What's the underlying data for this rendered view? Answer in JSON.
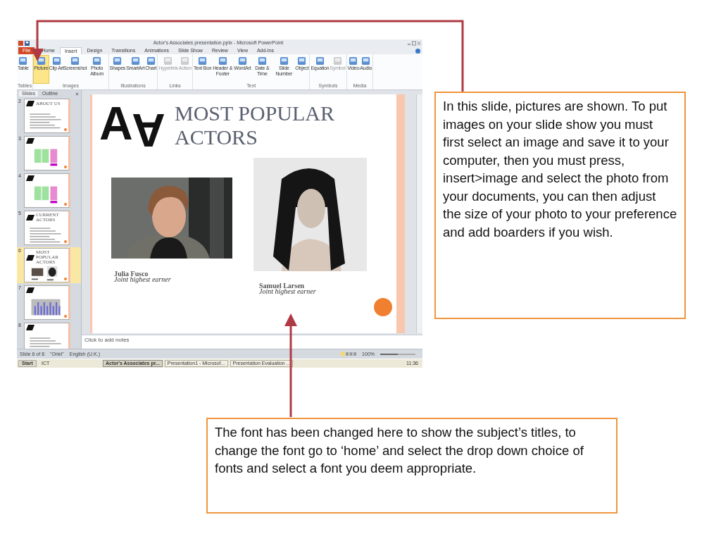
{
  "window": {
    "title": "Actor's Associates presentation.pptx - Microsoft PowerPoint"
  },
  "ribbon_tabs": [
    {
      "label": "File",
      "kind": "file",
      "selected": false
    },
    {
      "label": "Home",
      "kind": "tab",
      "selected": false
    },
    {
      "label": "Insert",
      "kind": "tab",
      "selected": true
    },
    {
      "label": "Design",
      "kind": "tab",
      "selected": false
    },
    {
      "label": "Transitions",
      "kind": "tab",
      "selected": false
    },
    {
      "label": "Animations",
      "kind": "tab",
      "selected": false
    },
    {
      "label": "Slide Show",
      "kind": "tab",
      "selected": false
    },
    {
      "label": "Review",
      "kind": "tab",
      "selected": false
    },
    {
      "label": "View",
      "kind": "tab",
      "selected": false
    },
    {
      "label": "Add-Ins",
      "kind": "tab",
      "selected": false
    }
  ],
  "ribbon_groups": [
    {
      "name": "Tables",
      "buttons": [
        {
          "label": "Table",
          "selected": false,
          "disabled": false
        }
      ]
    },
    {
      "name": "Images",
      "buttons": [
        {
          "label": "Picture",
          "selected": true,
          "disabled": false
        },
        {
          "label": "Clip Art",
          "selected": false,
          "disabled": false
        },
        {
          "label": "Screenshot",
          "selected": false,
          "disabled": false
        },
        {
          "label": "Photo Album",
          "selected": false,
          "disabled": false
        }
      ]
    },
    {
      "name": "Illustrations",
      "buttons": [
        {
          "label": "Shapes",
          "selected": false,
          "disabled": false
        },
        {
          "label": "SmartArt",
          "selected": false,
          "disabled": false
        },
        {
          "label": "Chart",
          "selected": false,
          "disabled": false
        }
      ]
    },
    {
      "name": "Links",
      "buttons": [
        {
          "label": "Hyperlink",
          "selected": false,
          "disabled": true
        },
        {
          "label": "Action",
          "selected": false,
          "disabled": true
        }
      ]
    },
    {
      "name": "Text",
      "buttons": [
        {
          "label": "Text Box",
          "selected": false,
          "disabled": false
        },
        {
          "label": "Header & Footer",
          "selected": false,
          "disabled": false
        },
        {
          "label": "WordArt",
          "selected": false,
          "disabled": false
        },
        {
          "label": "Date & Time",
          "selected": false,
          "disabled": false
        },
        {
          "label": "Slide Number",
          "selected": false,
          "disabled": false
        },
        {
          "label": "Object",
          "selected": false,
          "disabled": false
        }
      ]
    },
    {
      "name": "Symbols",
      "buttons": [
        {
          "label": "Equation",
          "selected": false,
          "disabled": false
        },
        {
          "label": "Symbol",
          "selected": false,
          "disabled": true
        }
      ]
    },
    {
      "name": "Media",
      "buttons": [
        {
          "label": "Video",
          "selected": false,
          "disabled": false
        },
        {
          "label": "Audio",
          "selected": false,
          "disabled": false
        }
      ]
    }
  ],
  "pane_tabs": [
    {
      "label": "Slides",
      "selected": true
    },
    {
      "label": "Outline",
      "selected": false
    }
  ],
  "thumbnails": [
    {
      "number": "2",
      "title": "ABOUT US",
      "kind": "list",
      "selected": false
    },
    {
      "number": "3",
      "kind": "table",
      "selected": false
    },
    {
      "number": "4",
      "kind": "table",
      "selected": false
    },
    {
      "number": "5",
      "title": "CURRENT ACTORS",
      "kind": "list",
      "selected": false
    },
    {
      "number": "6",
      "title": "MOST POPULAR ACTORS",
      "kind": "photos",
      "selected": true
    },
    {
      "number": "7",
      "kind": "chart",
      "selected": false
    },
    {
      "number": "8",
      "kind": "list",
      "selected": false
    }
  ],
  "slide": {
    "logo": [
      "A",
      "A"
    ],
    "title": [
      "MOST POPULAR",
      "ACTORS"
    ],
    "people": [
      {
        "name": "Julia Fusco",
        "caption": "Joint highest earner",
        "kind": "picture"
      },
      {
        "name": "Samuel Larsen",
        "caption": "Joint highest earner",
        "kind": "picture"
      }
    ]
  },
  "notes": {
    "placeholder": "Click to add notes"
  },
  "status_bar": {
    "slide": "Slide 6 of 8",
    "theme": "\"Oriel\"",
    "language": "English (U.K.)",
    "zoom": "100%",
    "level": 0.5
  },
  "taskbar": {
    "start": "Start",
    "items": [
      {
        "label": "ICT",
        "selected": false
      },
      {
        "label": "Actor's Associates pr...",
        "selected": true
      },
      {
        "label": "Presentation1 - Microsof...",
        "selected": false
      },
      {
        "label": "Presentation Evaluation ...",
        "selected": false
      }
    ],
    "clock": "11:36"
  },
  "callouts": [
    {
      "text": "In this slide, pictures are shown. To put images on your slide show you must first select an image and save it to your computer, then you must press, insert>image and select the photo from your documents, you can then adjust the size of your photo to your preference and add boarders if you wish."
    },
    {
      "text": "The font has been changed here to show the subject’s titles, to change the font go to ‘home’ and select the drop down choice of fonts and select a font you deem appropriate."
    }
  ]
}
